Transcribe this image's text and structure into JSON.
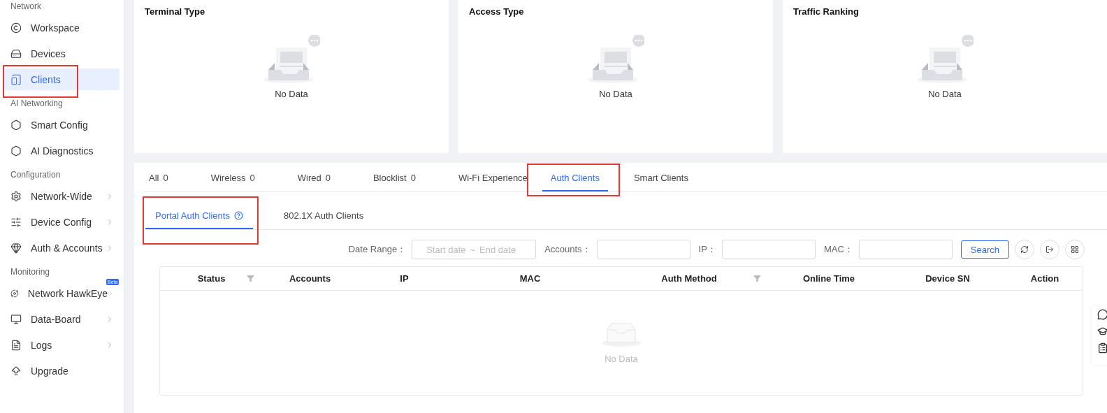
{
  "sidebar": {
    "sections": [
      {
        "label": "Network",
        "items": [
          {
            "label": "Workspace",
            "selected": false,
            "highlighted": false,
            "has_submenu": false
          },
          {
            "label": "Devices",
            "selected": false,
            "highlighted": false,
            "has_submenu": false
          },
          {
            "label": "Clients",
            "selected": true,
            "highlighted": true,
            "has_submenu": false
          }
        ]
      },
      {
        "label": "AI Networking",
        "items": [
          {
            "label": "Smart Config",
            "selected": false,
            "highlighted": false,
            "has_submenu": false
          },
          {
            "label": "AI Diagnostics",
            "selected": false,
            "highlighted": false,
            "has_submenu": false
          }
        ]
      },
      {
        "label": "Configuration",
        "items": [
          {
            "label": "Network-Wide",
            "selected": false,
            "highlighted": false,
            "has_submenu": true
          },
          {
            "label": "Device Config",
            "selected": false,
            "highlighted": false,
            "has_submenu": true
          },
          {
            "label": "Auth & Accounts",
            "selected": false,
            "highlighted": false,
            "has_submenu": true
          }
        ]
      },
      {
        "label": "Monitoring",
        "items": [
          {
            "label": "Network HawkEye",
            "selected": false,
            "highlighted": false,
            "has_submenu": true,
            "badge": "Beta"
          },
          {
            "label": "Data-Board",
            "selected": false,
            "highlighted": false,
            "has_submenu": true
          },
          {
            "label": "Logs",
            "selected": false,
            "highlighted": false,
            "has_submenu": true
          },
          {
            "label": "Upgrade",
            "selected": false,
            "highlighted": false,
            "has_submenu": false
          }
        ]
      }
    ]
  },
  "cards": [
    {
      "title": "Terminal Type",
      "empty_text": "No Data"
    },
    {
      "title": "Access Type",
      "empty_text": "No Data"
    },
    {
      "title": "Traffic Ranking",
      "empty_text": "No Data"
    }
  ],
  "tabs": [
    {
      "label": "All",
      "count": "0",
      "selected": false,
      "highlighted": false
    },
    {
      "label": "Wireless",
      "count": "0",
      "selected": false,
      "highlighted": false
    },
    {
      "label": "Wired",
      "count": "0",
      "selected": false,
      "highlighted": false
    },
    {
      "label": "Blocklist",
      "count": "0",
      "selected": false,
      "highlighted": false
    },
    {
      "label": "Wi-Fi Experience",
      "selected": false,
      "highlighted": false
    },
    {
      "label": "Auth Clients",
      "selected": true,
      "highlighted": true
    },
    {
      "label": "Smart Clients",
      "selected": false,
      "highlighted": false
    }
  ],
  "subtabs": [
    {
      "label": "Portal Auth Clients",
      "selected": true,
      "highlighted": true,
      "help": true
    },
    {
      "label": "802.1X Auth Clients",
      "selected": false,
      "highlighted": false,
      "help": false
    }
  ],
  "filters": {
    "date_range": {
      "label": "Date Range：",
      "start_placeholder": "Start date",
      "separator": "~",
      "end_placeholder": "End date"
    },
    "fields": [
      {
        "label": "Accounts："
      },
      {
        "label": "IP："
      },
      {
        "label": "MAC："
      }
    ],
    "search_button": "Search"
  },
  "table": {
    "columns": [
      {
        "label": "Status",
        "filter": true
      },
      {
        "label": "Accounts",
        "filter": false
      },
      {
        "label": "IP",
        "filter": false
      },
      {
        "label": "MAC",
        "filter": false
      },
      {
        "label": "Auth Method",
        "filter": true
      },
      {
        "label": "Online Time",
        "filter": false
      },
      {
        "label": "Device SN",
        "filter": false
      },
      {
        "label": "Action",
        "filter": false
      }
    ],
    "empty_text": "No Data"
  }
}
